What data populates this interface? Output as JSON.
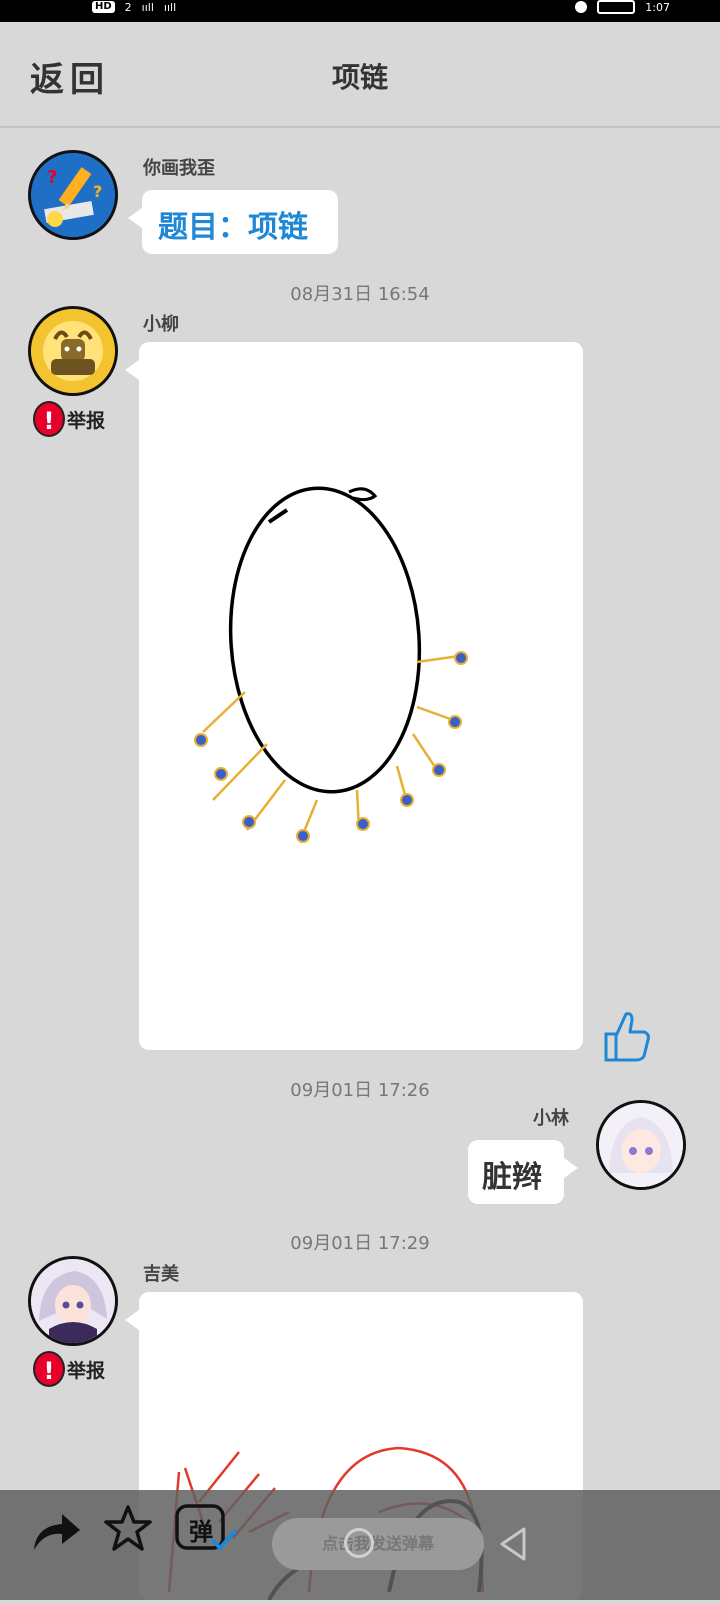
{
  "status_bar": {
    "hd_badge": "HD",
    "sim_count": "2",
    "signal_1": "ııll",
    "signal_2": "ııll",
    "time": "1:07"
  },
  "header": {
    "back_label": "返回",
    "title": "项链"
  },
  "messages": [
    {
      "sender": "你画我歪",
      "text": "题目：项链",
      "text_color": "#1e88d6"
    },
    {
      "timestamp": "08月31日  16:54",
      "sender": "小柳",
      "report_label": "举报"
    },
    {
      "timestamp": "09月01日  17:26",
      "sender": "小林",
      "text": "脏辫"
    },
    {
      "timestamp": "09月01日  17:29",
      "sender": "吉美",
      "report_label": "举报"
    }
  ],
  "bottom_bar": {
    "danmaku_placeholder": "点击我发送弹幕",
    "danmaku_toggle_glyph": "弹"
  },
  "colors": {
    "background": "#d8d8d8",
    "accent_blue": "#1e88d6",
    "report_red": "#e6002a",
    "necklace_gold": "#e6b033",
    "bead_blue": "#3a5fc8"
  },
  "icons": [
    "back-icon",
    "pencil-avatar-icon",
    "thumbs-up-icon",
    "share-icon",
    "star-icon",
    "danmaku-toggle-icon",
    "home-nav-icon",
    "back-nav-icon"
  ]
}
